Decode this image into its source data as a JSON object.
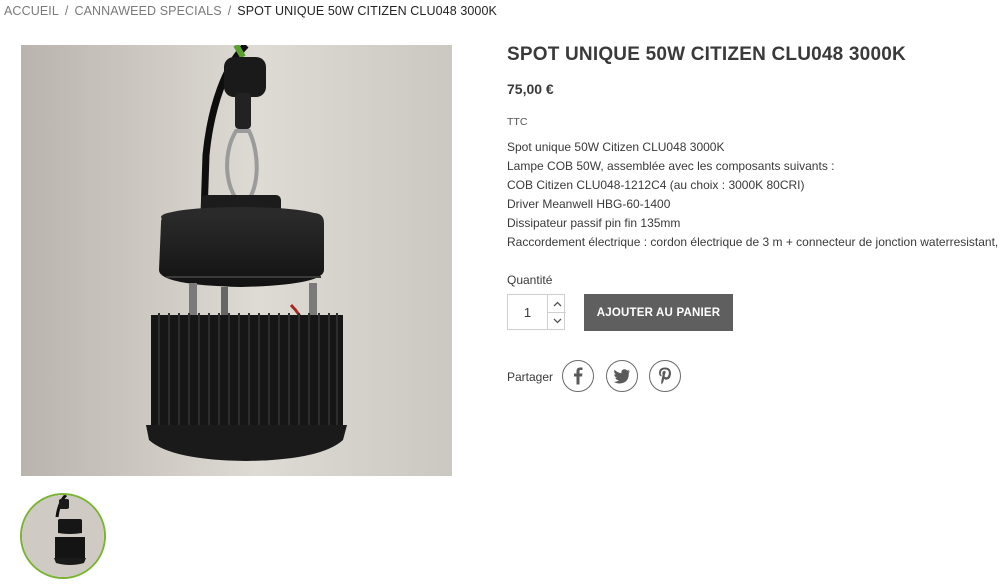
{
  "breadcrumb": {
    "items": [
      "ACCUEIL",
      "CANNAWEED SPECIALS",
      "SPOT UNIQUE 50W CITIZEN CLU048 3000K"
    ],
    "separator": "/"
  },
  "product": {
    "title": "SPOT UNIQUE 50W CITIZEN CLU048 3000K",
    "price": "75,00 €",
    "tax_label": "TTC",
    "description": [
      "Spot unique 50W Citizen CLU048 3000K",
      "Lampe COB 50W, assemblée avec les composants suivants :",
      "COB Citizen CLU048-1212C4 (au choix : 3000K 80CRI)",
      "Driver Meanwell HBG-60-1400",
      "Dissipateur passif pin fin 135mm",
      "Raccordement électrique :  cordon électrique de 3 m + connecteur de jonction waterresistant,"
    ]
  },
  "quantity": {
    "label": "Quantité",
    "value": "1"
  },
  "cart": {
    "button_label": "AJOUTER AU PANIER"
  },
  "share": {
    "label": "Partager",
    "networks": [
      "facebook-icon",
      "twitter-icon",
      "pinterest-icon"
    ]
  },
  "colors": {
    "accent_green": "#7bb334",
    "button_gray": "#5f5f5f",
    "text_dark": "#3a3a3a"
  }
}
